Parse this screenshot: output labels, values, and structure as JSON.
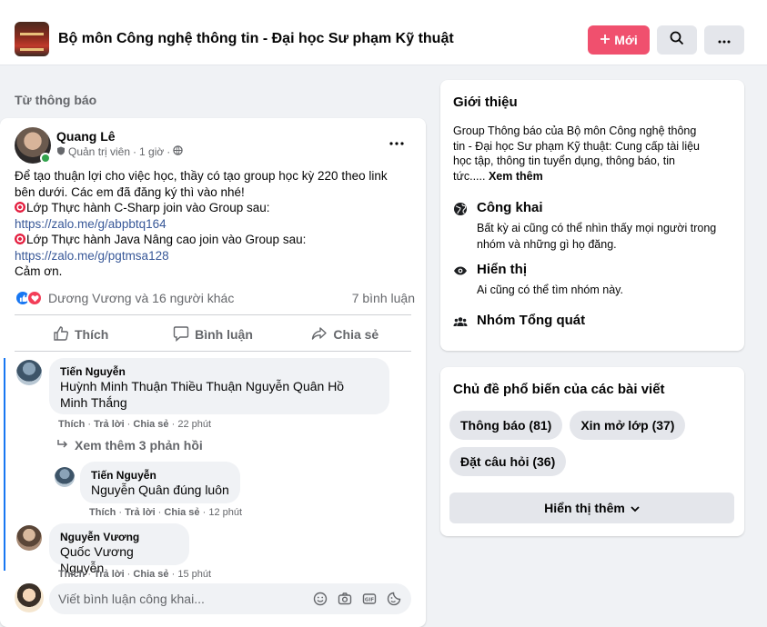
{
  "header": {
    "group_title": "Bộ môn Công nghệ thông tin - Đại học Sư phạm Kỹ thuật",
    "new_button": "Mới",
    "accent_color": "#f0506e"
  },
  "feed": {
    "section_label": "Từ thông báo"
  },
  "post": {
    "author": "Quang Lê",
    "role": "Quản trị viên",
    "time": "1 giờ",
    "lines": [
      "Để tạo thuận lợi cho việc học, thầy có tạo group học kỳ 220 theo link",
      "bên dưới. Các em đã đăng ký thì vào nhé!",
      "Lớp Thực hành C-Sharp join vào Group sau:",
      "https://zalo.me/g/abpbtq164",
      "Lớp Thực hành Java Nâng cao join vào Group sau:",
      "https://zalo.me/g/pgtmsa128",
      "Cảm ơn."
    ],
    "reactions_text": "Dương Vương và 16 người khác",
    "comment_count": "7 bình luận",
    "actions": {
      "like": "Thích",
      "comment": "Bình luận",
      "share": "Chia sẻ"
    }
  },
  "comments": [
    {
      "name": "Tiến Nguyễn",
      "text_line1": "Huỳnh Minh Thuận Thiều Thuận Nguyễn Quân Hồ",
      "text_line2": "Minh Thắng",
      "like": "Thích",
      "reply": "Trả lời",
      "share": "Chia sẻ",
      "time": "22 phút"
    },
    {
      "name": "Tiến Nguyễn",
      "text": "Nguyễn Quân đúng luôn",
      "like": "Thích",
      "reply": "Trả lời",
      "share": "Chia sẻ",
      "time": "12 phút"
    },
    {
      "name": "Nguyễn Vương",
      "text": "Quốc Vương Nguyễn",
      "like": "Thích",
      "reply": "Trả lời",
      "share": "Chia sẻ",
      "time": "15 phút"
    }
  ],
  "more_replies": "Xem thêm 3 phản hồi",
  "composer": {
    "placeholder": "Viết bình luận công khai..."
  },
  "about": {
    "title": "Giới thiệu",
    "desc_line1": "Group Thông báo của Bộ môn Công nghệ thông",
    "desc_line2": "tin - Đại học Sư phạm Kỹ thuật: Cung cấp tài liệu",
    "desc_line3": "học tập, thông tin tuyển dụng, thông báo, tin",
    "desc_line4": "tức.....",
    "see_more": "Xem thêm",
    "public_title": "Công khai",
    "public_desc": "Bất kỳ ai cũng có thể nhìn thấy mọi người trong nhóm và những gì họ đăng.",
    "visible_title": "Hiển thị",
    "visible_desc": "Ai cũng có thể tìm nhóm này.",
    "general_title": "Nhóm Tổng quát"
  },
  "topics": {
    "title": "Chủ đề phổ biến của các bài viết",
    "chips": [
      "Thông báo (81)",
      "Xin mở lớp (37)",
      "Đặt câu hỏi (36)"
    ],
    "show_more": "Hiển thị thêm"
  }
}
